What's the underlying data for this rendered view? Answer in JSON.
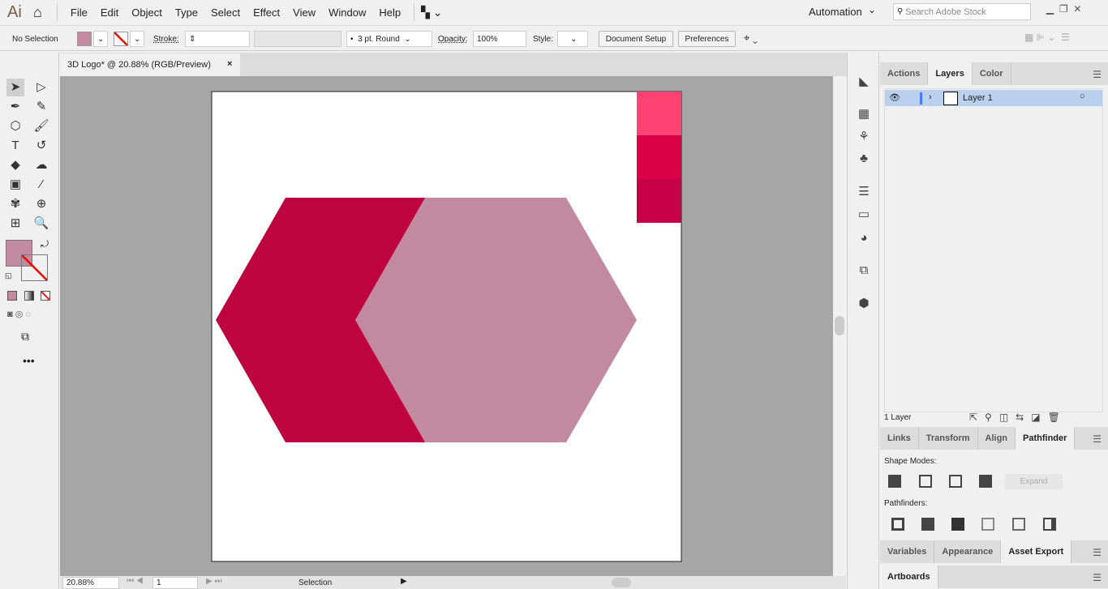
{
  "app": {
    "logo": "Ai",
    "menus": [
      "File",
      "Edit",
      "Object",
      "Type",
      "Select",
      "Effect",
      "View",
      "Window",
      "Help"
    ],
    "workspace": "Automation",
    "search_placeholder": "Search Adobe Stock"
  },
  "control": {
    "selection": "No Selection",
    "stroke_label": "Stroke:",
    "brush": "3 pt. Round",
    "opacity_label": "Opacity:",
    "opacity": "100%",
    "style_label": "Style:",
    "document_setup": "Document Setup",
    "preferences": "Preferences",
    "fill_color": "#c28a9e"
  },
  "document": {
    "tab_title": "3D Logo* @ 20.88% (RGB/Preview)",
    "close": "×"
  },
  "artwork": {
    "swatches": [
      "#ff4274",
      "#dc0048",
      "#c50045"
    ],
    "dark_hex": "#bd0441",
    "light_hex": "#c28a9e"
  },
  "status": {
    "zoom": "20.88%",
    "artboard": "1",
    "tool": "Selection"
  },
  "layers_panel": {
    "tabs": [
      "Actions",
      "Layers",
      "Color"
    ],
    "layer_name": "Layer 1",
    "count": "1 Layer"
  },
  "pathfinder_panel": {
    "tabs": [
      "Links",
      "Transform",
      "Align",
      "Pathfinder"
    ],
    "shape_modes": "Shape Modes:",
    "expand": "Expand",
    "pathfinders": "Pathfinders:"
  },
  "bottom_tabs": [
    "Variables",
    "Appearance",
    "Asset Export"
  ],
  "artboards_tab": "Artboards"
}
